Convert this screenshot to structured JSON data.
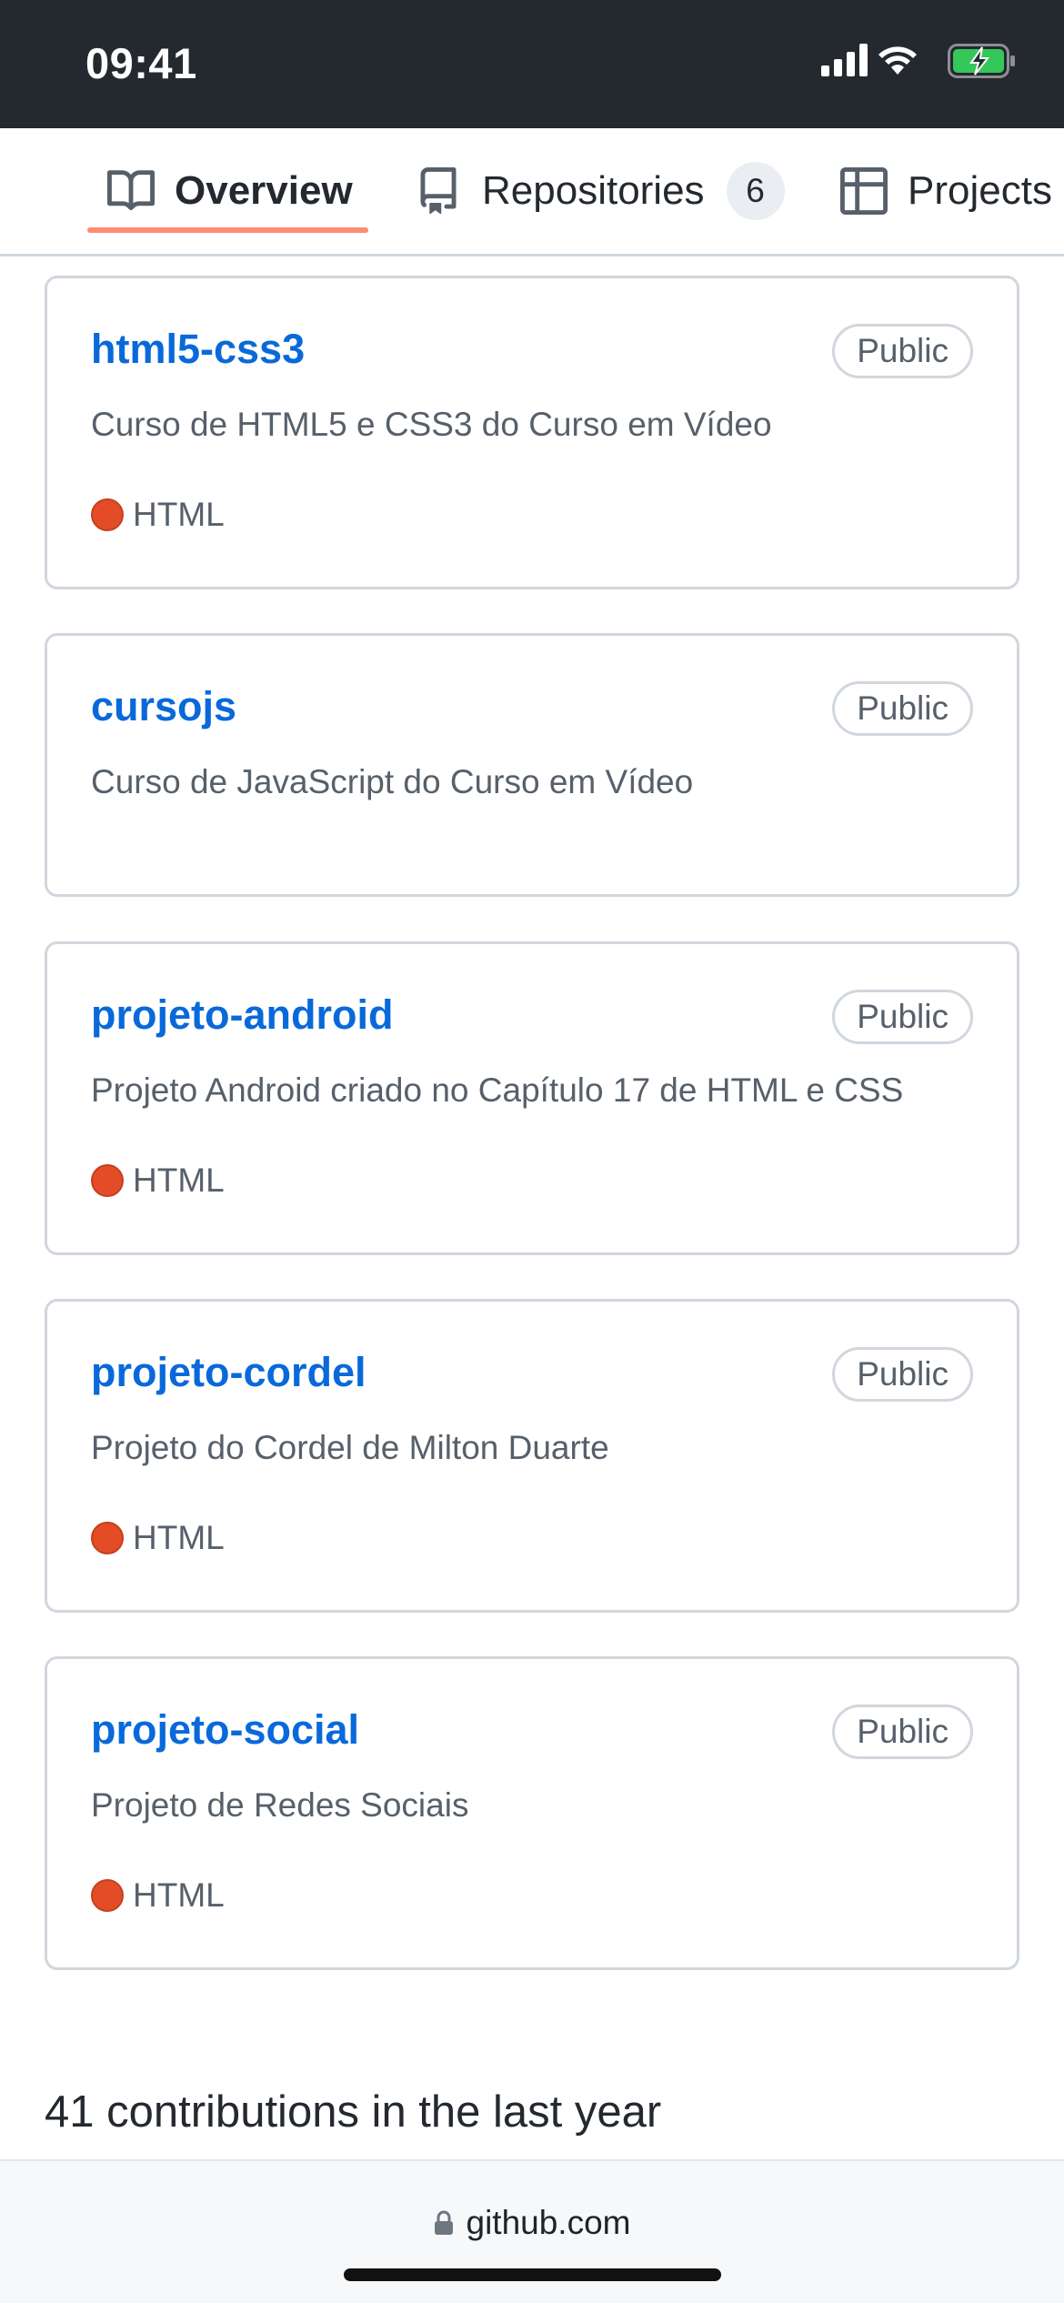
{
  "status_bar": {
    "time": "09:41"
  },
  "tabs": [
    {
      "label": "Overview",
      "icon": "book-icon",
      "active": true
    },
    {
      "label": "Repositories",
      "icon": "repo-icon",
      "count": "6"
    },
    {
      "label": "Projects",
      "icon": "project-table-icon"
    }
  ],
  "repositories": [
    {
      "name": "html5-css3",
      "visibility": "Public",
      "description": "Curso de HTML5 e CSS3 do Curso em Vídeo",
      "language": "HTML"
    },
    {
      "name": "cursojs",
      "visibility": "Public",
      "description": "Curso de JavaScript do Curso em Vídeo",
      "language": ""
    },
    {
      "name": "projeto-android",
      "visibility": "Public",
      "description": "Projeto Android criado no Capítulo 17 de HTML e CSS",
      "language": "HTML"
    },
    {
      "name": "projeto-cordel",
      "visibility": "Public",
      "description": "Projeto do Cordel de Milton Duarte",
      "language": "HTML"
    },
    {
      "name": "projeto-social",
      "visibility": "Public",
      "description": "Projeto de Redes Sociais",
      "language": "HTML"
    }
  ],
  "contributions": {
    "heading": "41 contributions in the last year"
  },
  "browser": {
    "url": "github.com"
  },
  "colors": {
    "link": "#0969da",
    "html_language": "#e34c26",
    "tab_underline": "#fd8c73",
    "status_bar_bg": "#24292f",
    "battery_green": "#34c759"
  }
}
